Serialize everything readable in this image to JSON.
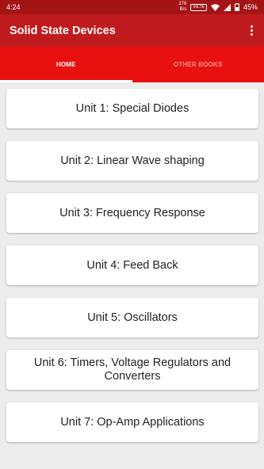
{
  "status_bar": {
    "time": "4:24",
    "speed_value": "276",
    "speed_unit": "B/s",
    "volte": "VoLTE",
    "battery": "45%"
  },
  "app_bar": {
    "title": "Solid State Devices",
    "menu_icon": "overflow-menu-icon"
  },
  "tabs": [
    {
      "label": "HOME",
      "active": true
    },
    {
      "label": "OTHER BOOKS",
      "active": false
    }
  ],
  "units": [
    {
      "label": "Unit 1: Special Diodes"
    },
    {
      "label": "Unit 2: Linear Wave shaping"
    },
    {
      "label": "Unit 3: Frequency Response"
    },
    {
      "label": "Unit 4: Feed Back"
    },
    {
      "label": "Unit 5: Oscillators"
    },
    {
      "label": "Unit 6: Timers, Voltage Regulators and Converters"
    },
    {
      "label": "Unit 7: Op-Amp Applications"
    }
  ],
  "colors": {
    "status_bar": "#a41416",
    "app_bar": "#bf1b1e",
    "tabs": "#e8110f"
  }
}
